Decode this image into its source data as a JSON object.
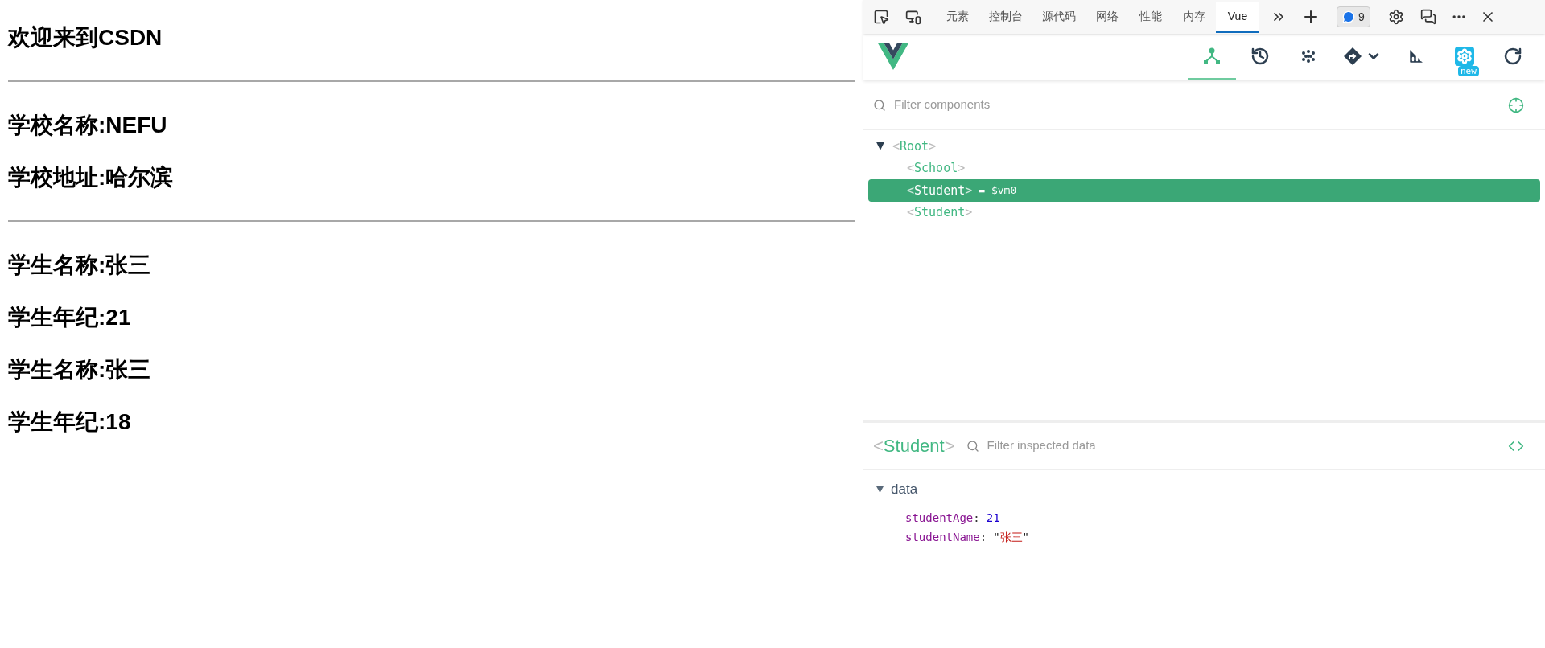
{
  "page": {
    "blocks": [
      {
        "kind": "heading",
        "text": "欢迎来到CSDN"
      },
      {
        "kind": "rule"
      },
      {
        "kind": "heading",
        "text": "学校名称:NEFU"
      },
      {
        "kind": "heading",
        "text": "学校地址:哈尔滨"
      },
      {
        "kind": "rule"
      },
      {
        "kind": "heading",
        "text": "学生名称:张三"
      },
      {
        "kind": "heading",
        "text": "学生年纪:21"
      },
      {
        "kind": "heading",
        "text": "学生名称:张三"
      },
      {
        "kind": "heading",
        "text": "学生年纪:18"
      }
    ]
  },
  "devtools": {
    "tabs": [
      {
        "label": "元素",
        "selected": false
      },
      {
        "label": "控制台",
        "selected": false
      },
      {
        "label": "源代码",
        "selected": false
      },
      {
        "label": "网络",
        "selected": false
      },
      {
        "label": "性能",
        "selected": false
      },
      {
        "label": "内存",
        "selected": false
      },
      {
        "label": "Vue",
        "selected": true
      }
    ],
    "issues_count": "9",
    "vue_tools": [
      {
        "kind": "components",
        "selected": true
      },
      {
        "kind": "timeline",
        "selected": false
      },
      {
        "kind": "pinia",
        "selected": false
      },
      {
        "kind": "router",
        "selected": false
      },
      {
        "kind": "performance",
        "selected": false
      },
      {
        "kind": "settings",
        "selected": false,
        "badge": "new"
      },
      {
        "kind": "refresh",
        "selected": false
      }
    ],
    "component_filter": {
      "placeholder": "Filter components"
    },
    "tree": [
      {
        "open": "<",
        "name": "Root",
        "close": ">",
        "expanded": true,
        "selected": false,
        "children": [
          {
            "open": "<",
            "name": "School",
            "close": ">",
            "selected": false
          },
          {
            "open": "<",
            "name": "Student",
            "close": ">",
            "selected": true,
            "suffix": "= $vm0"
          },
          {
            "open": "<",
            "name": "Student",
            "close": ">",
            "selected": false
          }
        ]
      }
    ],
    "inspector": {
      "open": "<",
      "name": "Student",
      "close": ">",
      "filter": {
        "placeholder": "Filter inspected data"
      },
      "section": {
        "label": "data",
        "expanded": true,
        "props": [
          {
            "key": "studentAge",
            "colon": ":",
            "kind": "number",
            "value": "21"
          },
          {
            "key": "studentName",
            "colon": ":",
            "kind": "string",
            "quote_open": "\"",
            "value": "张三",
            "quote_close": "\""
          }
        ]
      }
    }
  }
}
